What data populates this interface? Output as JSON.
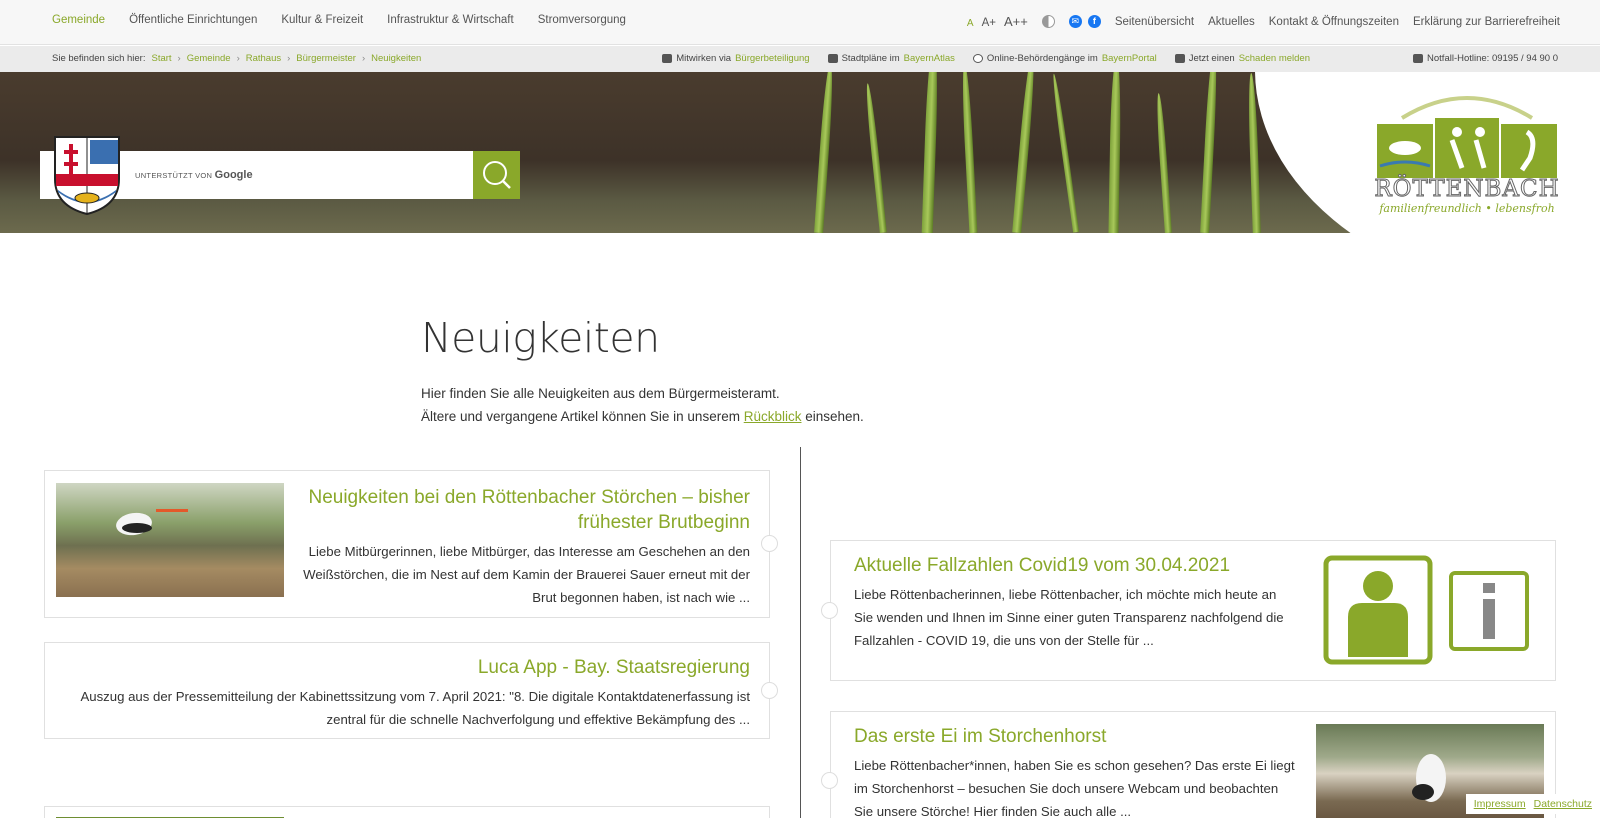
{
  "mainmenu": {
    "items": [
      "Gemeinde",
      "Öffentliche Einrichtungen",
      "Kultur & Freizeit",
      "Infrastruktur & Wirtschaft",
      "Stromversorgung"
    ]
  },
  "utility": {
    "font_small": "A",
    "font_medium": "A+",
    "font_large": "A++",
    "links": [
      "Seitenübersicht",
      "Aktuelles",
      "Kontakt & Öffnungszeiten",
      "Erklärung zur Barrierefreiheit"
    ]
  },
  "breadcrumb": {
    "prefix": "Sie befinden sich hier:",
    "items": [
      "Start",
      "Gemeinde",
      "Rathaus",
      "Bürgermeister",
      "Neuigkeiten"
    ]
  },
  "services": [
    {
      "text": "Mitwirken via",
      "link": "Bürgerbeteiligung"
    },
    {
      "text": "Stadtpläne im",
      "link": "BayernAtlas"
    },
    {
      "text": "Online-Behördengänge im",
      "link": "BayernPortal"
    },
    {
      "text": "Jetzt einen",
      "link": "Schaden melden"
    }
  ],
  "hotline": "Notfall-Hotline: 09195 / 94 90 0",
  "search": {
    "powered_label": "UNTERSTÜTZT VON",
    "powered_brand": "Google"
  },
  "logo": {
    "name": "RÖTTENBACH",
    "tagline": "familienfreundlich • lebensfroh"
  },
  "page": {
    "title": "Neuigkeiten",
    "intro_line1": "Hier finden Sie alle Neuigkeiten aus dem Bürgermeisteramt.",
    "intro_line2_pre": "Ältere und vergangene Artikel können Sie in unserem",
    "intro_link": "Rückblick",
    "intro_line2_post": "einsehen."
  },
  "news": [
    {
      "title": "Neuigkeiten bei den Röttenbacher Störchen – bisher frühester Brutbeginn",
      "text": "Liebe Mitbürgerinnen, liebe Mitbürger,   das Interesse am Geschehen an den Weißstörchen, die im Nest auf dem Kamin der Brauerei Sauer erneut mit der Brut begonnen haben, ist nach wie ..."
    },
    {
      "title": "Luca App - Bay. Staatsregierung",
      "text": "Auszug aus der Pressemitteilung der Kabinettssitzung vom 7. April 2021: \"8. Die digitale Kontaktdatenerfassung ist zentral für die schnelle Nachverfolgung und effektive Bekämpfung des ..."
    },
    {
      "title": "Aktuelle Fallzahlen Covid19 vom 30.04.2021",
      "text": "Liebe Röttenbacherinnen, liebe Röttenbacher, ich möchte mich heute an Sie wenden und Ihnen im Sinne einer guten Transparenz nachfolgend die Fallzahlen - COVID 19, die uns von der Stelle für ..."
    },
    {
      "title": "Das erste Ei im Storchenhorst",
      "text": "Liebe Röttenbacher*innen, haben Sie es schon gesehen? Das erste Ei liegt im Storchenhorst – besuchen Sie doch unsere Webcam und beobachten Sie unsere Störche! Hier finden Sie auch alle ..."
    }
  ],
  "footer": {
    "impressum": "Impressum",
    "datenschutz": "Datenschutz"
  },
  "colors": {
    "accent": "#8aa82a",
    "text": "#333333"
  }
}
